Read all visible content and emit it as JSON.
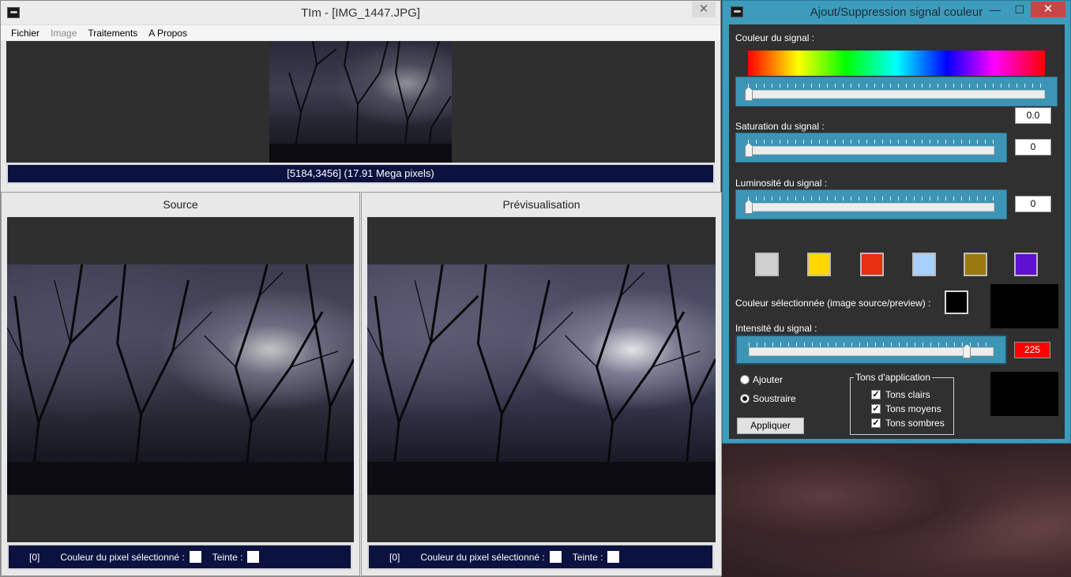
{
  "main_window": {
    "title": "TIm - [IMG_1447.JPG]",
    "close_label": "✕",
    "menu": [
      {
        "label": "Fichier",
        "enabled": true
      },
      {
        "label": "Image",
        "enabled": false
      },
      {
        "label": "Traitements",
        "enabled": true
      },
      {
        "label": "A Propos",
        "enabled": true
      }
    ],
    "image_info": "[5184,3456] (17.91 Mega pixels)",
    "source_panel": {
      "title": "Source",
      "status_index": "[0]",
      "pixel_color_label": "Couleur du pixel sélectionné :",
      "hue_label": "Teinte :"
    },
    "preview_panel": {
      "title": "Prévisualisation",
      "status_index": "[0]",
      "pixel_color_label": "Couleur du pixel sélectionné :",
      "hue_label": "Teinte :"
    }
  },
  "dialog": {
    "title": "Ajout/Suppression signal couleur",
    "minimize_label": "—",
    "maximize_label": "☐",
    "close_label": "✕",
    "signal_color_label": "Couleur du signal :",
    "hue_value": "0.0",
    "saturation_label": "Saturation du signal :",
    "saturation_value": "0",
    "luminosity_label": "Luminosité du signal :",
    "luminosity_value": "0",
    "preset_colors": [
      "#d0d0d0",
      "#ffd700",
      "#e63010",
      "#a8d0ff",
      "#9a7a10",
      "#6010d0"
    ],
    "selected_color_label": "Couleur sélectionnée (image source/preview) :",
    "intensity_label": "Intensité du signal :",
    "intensity_value": "225",
    "intensity_fraction": 0.88,
    "mode_add_label": "Ajouter",
    "mode_subtract_label": "Soustraire",
    "selected_mode": "subtract",
    "tones_group_label": "Tons d'application",
    "tones": [
      {
        "label": "Tons clairs",
        "checked": true
      },
      {
        "label": "Tons moyens",
        "checked": true
      },
      {
        "label": "Tons sombres",
        "checked": true
      }
    ],
    "apply_label": "Appliquer"
  }
}
